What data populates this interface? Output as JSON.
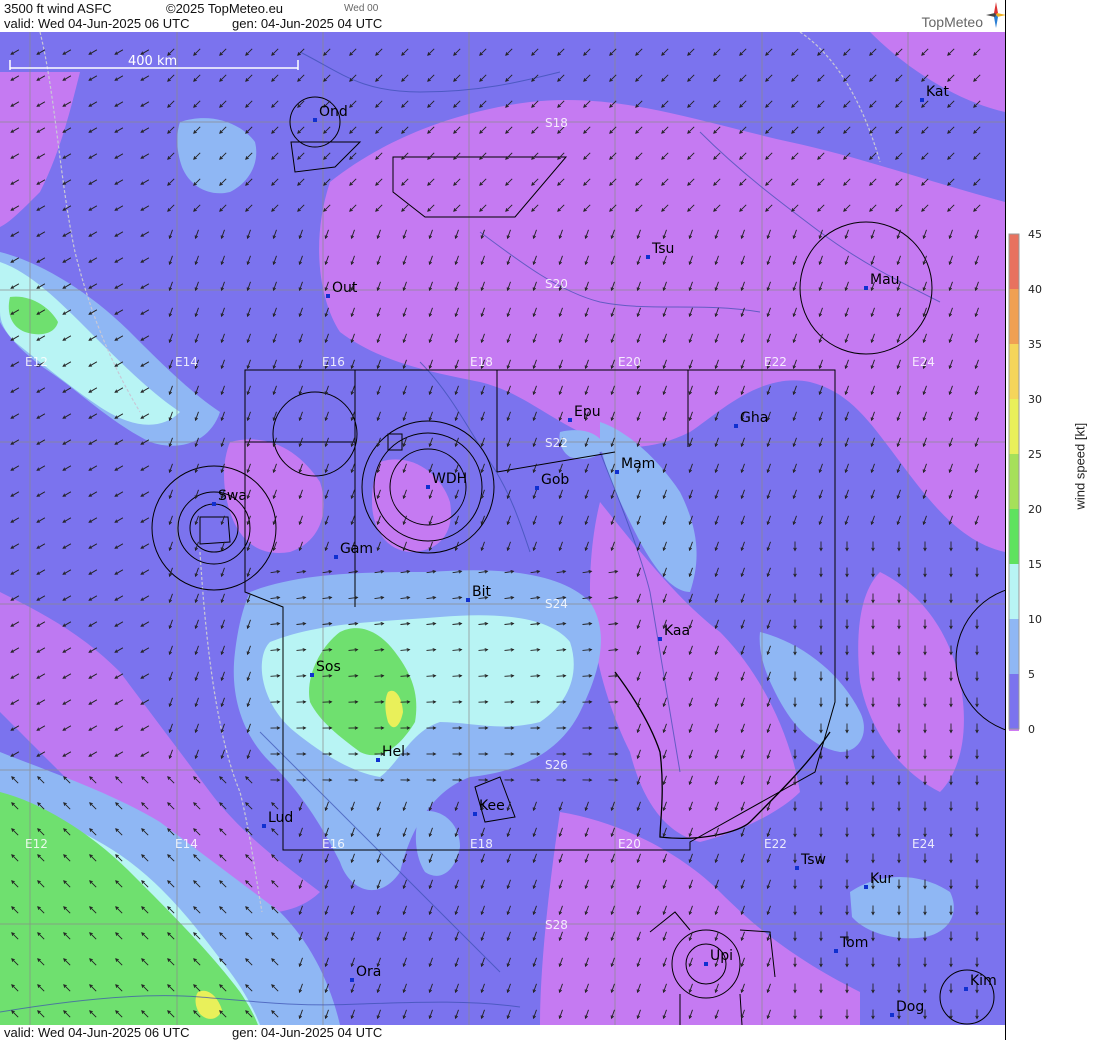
{
  "header": {
    "product": "3500 ft wind ASFC",
    "copyright": "©2025 TopMeteo.eu",
    "day_tag": "Wed 00",
    "valid": "valid:  Wed  04-Jun-2025  06 UTC",
    "generated": "gen: 04-Jun-2025 04 UTC",
    "brand": "TopMeteo"
  },
  "footer": {
    "valid": "valid:  Wed  04-Jun-2025  06 UTC",
    "generated": "gen: 04-Jun-2025 04 UTC"
  },
  "scale_bar": {
    "label": "400 km"
  },
  "colorbar": {
    "title": "wind speed [kt]",
    "ticks": [
      "45",
      "40",
      "35",
      "30",
      "25",
      "20",
      "15",
      "10",
      "5",
      "0"
    ],
    "colors": [
      "#e8725f",
      "#f0a053",
      "#f5d55a",
      "#e9f05a",
      "#a6e05a",
      "#5fe25f",
      "#b8f4f4",
      "#8fb7f4",
      "#7b73ee",
      "#cf7af4"
    ]
  },
  "grid_labels": {
    "longitude": [
      "E12",
      "E14",
      "E16",
      "E18",
      "E20",
      "E22",
      "E24"
    ],
    "latitude": [
      "S18",
      "S20",
      "S22",
      "S24",
      "S26",
      "S28"
    ]
  },
  "places": [
    "Ond",
    "Kat",
    "Tsu",
    "Mau",
    "Out",
    "Epu",
    "Gha",
    "Mam",
    "Gob",
    "WDH",
    "Swa",
    "Gam",
    "Bit",
    "Kaa",
    "Sos",
    "Hel",
    "Kee",
    "Lud",
    "Tsw",
    "Kur",
    "Tom",
    "Upi",
    "Ora",
    "Kim",
    "Dog"
  ]
}
